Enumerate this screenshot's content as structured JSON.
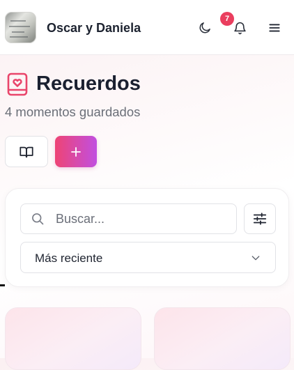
{
  "header": {
    "title": "Oscar y Daniela",
    "avatar": "couple-photo",
    "notification_count": "7",
    "icons": [
      "moon-icon",
      "bell-icon",
      "menu-icon"
    ]
  },
  "page": {
    "title": "Recuerdos",
    "subtitle": "4 momentos guardados",
    "icon": "heart-book-icon"
  },
  "actions": {
    "book_icon": "open-book-icon",
    "add_label": "+"
  },
  "filters": {
    "search_placeholder": "Buscar...",
    "search_value": "",
    "filters_icon": "sliders-icon",
    "sort_selected": "Más reciente"
  },
  "colors": {
    "accent_pink": "#ee4475",
    "accent_purple": "#c14fe0",
    "badge": "#ea3e5e",
    "title": "#1a2030",
    "muted": "#6a6f78"
  },
  "memories": [
    {
      "id": "card-1"
    },
    {
      "id": "card-2"
    }
  ]
}
